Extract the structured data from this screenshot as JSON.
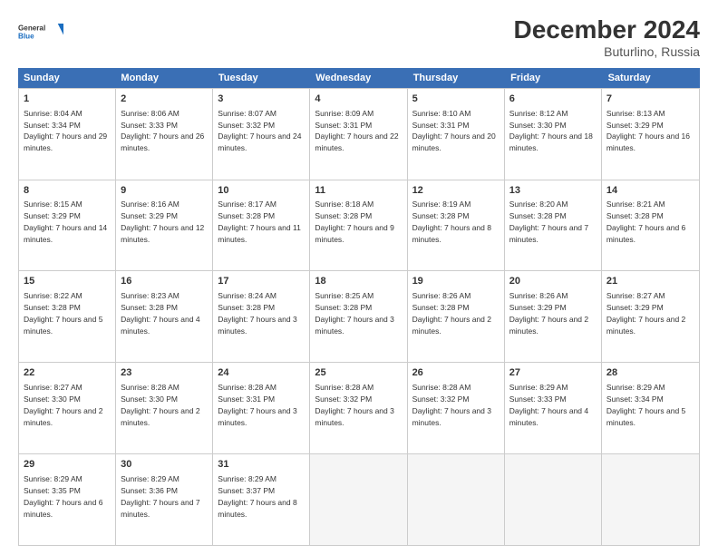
{
  "logo": {
    "general": "General",
    "blue": "Blue"
  },
  "title": "December 2024",
  "subtitle": "Buturlino, Russia",
  "header_days": [
    "Sunday",
    "Monday",
    "Tuesday",
    "Wednesday",
    "Thursday",
    "Friday",
    "Saturday"
  ],
  "weeks": [
    [
      {
        "day": "1",
        "sunrise": "Sunrise: 8:04 AM",
        "sunset": "Sunset: 3:34 PM",
        "daylight": "Daylight: 7 hours and 29 minutes."
      },
      {
        "day": "2",
        "sunrise": "Sunrise: 8:06 AM",
        "sunset": "Sunset: 3:33 PM",
        "daylight": "Daylight: 7 hours and 26 minutes."
      },
      {
        "day": "3",
        "sunrise": "Sunrise: 8:07 AM",
        "sunset": "Sunset: 3:32 PM",
        "daylight": "Daylight: 7 hours and 24 minutes."
      },
      {
        "day": "4",
        "sunrise": "Sunrise: 8:09 AM",
        "sunset": "Sunset: 3:31 PM",
        "daylight": "Daylight: 7 hours and 22 minutes."
      },
      {
        "day": "5",
        "sunrise": "Sunrise: 8:10 AM",
        "sunset": "Sunset: 3:31 PM",
        "daylight": "Daylight: 7 hours and 20 minutes."
      },
      {
        "day": "6",
        "sunrise": "Sunrise: 8:12 AM",
        "sunset": "Sunset: 3:30 PM",
        "daylight": "Daylight: 7 hours and 18 minutes."
      },
      {
        "day": "7",
        "sunrise": "Sunrise: 8:13 AM",
        "sunset": "Sunset: 3:29 PM",
        "daylight": "Daylight: 7 hours and 16 minutes."
      }
    ],
    [
      {
        "day": "8",
        "sunrise": "Sunrise: 8:15 AM",
        "sunset": "Sunset: 3:29 PM",
        "daylight": "Daylight: 7 hours and 14 minutes."
      },
      {
        "day": "9",
        "sunrise": "Sunrise: 8:16 AM",
        "sunset": "Sunset: 3:29 PM",
        "daylight": "Daylight: 7 hours and 12 minutes."
      },
      {
        "day": "10",
        "sunrise": "Sunrise: 8:17 AM",
        "sunset": "Sunset: 3:28 PM",
        "daylight": "Daylight: 7 hours and 11 minutes."
      },
      {
        "day": "11",
        "sunrise": "Sunrise: 8:18 AM",
        "sunset": "Sunset: 3:28 PM",
        "daylight": "Daylight: 7 hours and 9 minutes."
      },
      {
        "day": "12",
        "sunrise": "Sunrise: 8:19 AM",
        "sunset": "Sunset: 3:28 PM",
        "daylight": "Daylight: 7 hours and 8 minutes."
      },
      {
        "day": "13",
        "sunrise": "Sunrise: 8:20 AM",
        "sunset": "Sunset: 3:28 PM",
        "daylight": "Daylight: 7 hours and 7 minutes."
      },
      {
        "day": "14",
        "sunrise": "Sunrise: 8:21 AM",
        "sunset": "Sunset: 3:28 PM",
        "daylight": "Daylight: 7 hours and 6 minutes."
      }
    ],
    [
      {
        "day": "15",
        "sunrise": "Sunrise: 8:22 AM",
        "sunset": "Sunset: 3:28 PM",
        "daylight": "Daylight: 7 hours and 5 minutes."
      },
      {
        "day": "16",
        "sunrise": "Sunrise: 8:23 AM",
        "sunset": "Sunset: 3:28 PM",
        "daylight": "Daylight: 7 hours and 4 minutes."
      },
      {
        "day": "17",
        "sunrise": "Sunrise: 8:24 AM",
        "sunset": "Sunset: 3:28 PM",
        "daylight": "Daylight: 7 hours and 3 minutes."
      },
      {
        "day": "18",
        "sunrise": "Sunrise: 8:25 AM",
        "sunset": "Sunset: 3:28 PM",
        "daylight": "Daylight: 7 hours and 3 minutes."
      },
      {
        "day": "19",
        "sunrise": "Sunrise: 8:26 AM",
        "sunset": "Sunset: 3:28 PM",
        "daylight": "Daylight: 7 hours and 2 minutes."
      },
      {
        "day": "20",
        "sunrise": "Sunrise: 8:26 AM",
        "sunset": "Sunset: 3:29 PM",
        "daylight": "Daylight: 7 hours and 2 minutes."
      },
      {
        "day": "21",
        "sunrise": "Sunrise: 8:27 AM",
        "sunset": "Sunset: 3:29 PM",
        "daylight": "Daylight: 7 hours and 2 minutes."
      }
    ],
    [
      {
        "day": "22",
        "sunrise": "Sunrise: 8:27 AM",
        "sunset": "Sunset: 3:30 PM",
        "daylight": "Daylight: 7 hours and 2 minutes."
      },
      {
        "day": "23",
        "sunrise": "Sunrise: 8:28 AM",
        "sunset": "Sunset: 3:30 PM",
        "daylight": "Daylight: 7 hours and 2 minutes."
      },
      {
        "day": "24",
        "sunrise": "Sunrise: 8:28 AM",
        "sunset": "Sunset: 3:31 PM",
        "daylight": "Daylight: 7 hours and 3 minutes."
      },
      {
        "day": "25",
        "sunrise": "Sunrise: 8:28 AM",
        "sunset": "Sunset: 3:32 PM",
        "daylight": "Daylight: 7 hours and 3 minutes."
      },
      {
        "day": "26",
        "sunrise": "Sunrise: 8:28 AM",
        "sunset": "Sunset: 3:32 PM",
        "daylight": "Daylight: 7 hours and 3 minutes."
      },
      {
        "day": "27",
        "sunrise": "Sunrise: 8:29 AM",
        "sunset": "Sunset: 3:33 PM",
        "daylight": "Daylight: 7 hours and 4 minutes."
      },
      {
        "day": "28",
        "sunrise": "Sunrise: 8:29 AM",
        "sunset": "Sunset: 3:34 PM",
        "daylight": "Daylight: 7 hours and 5 minutes."
      }
    ],
    [
      {
        "day": "29",
        "sunrise": "Sunrise: 8:29 AM",
        "sunset": "Sunset: 3:35 PM",
        "daylight": "Daylight: 7 hours and 6 minutes."
      },
      {
        "day": "30",
        "sunrise": "Sunrise: 8:29 AM",
        "sunset": "Sunset: 3:36 PM",
        "daylight": "Daylight: 7 hours and 7 minutes."
      },
      {
        "day": "31",
        "sunrise": "Sunrise: 8:29 AM",
        "sunset": "Sunset: 3:37 PM",
        "daylight": "Daylight: 7 hours and 8 minutes."
      },
      null,
      null,
      null,
      null
    ]
  ]
}
